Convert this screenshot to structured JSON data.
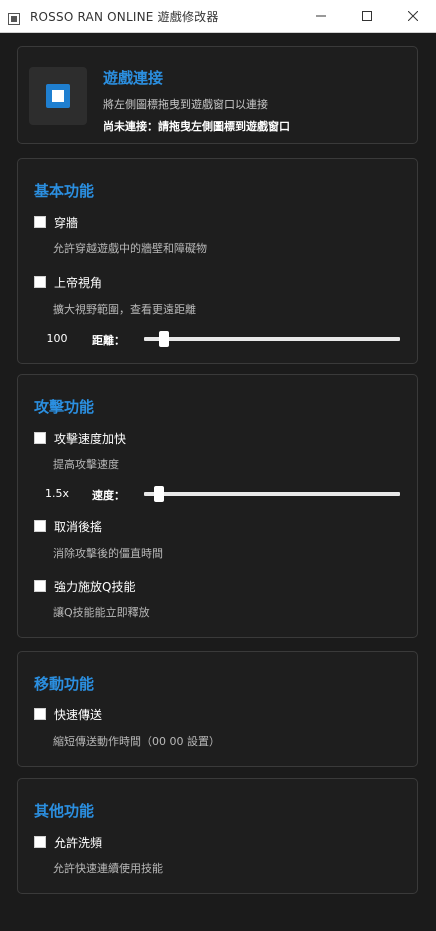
{
  "window": {
    "title": "ROSSO RAN ONLINE 遊戲修改器",
    "icon": "app-icon",
    "controls": [
      "minimize-icon",
      "maximize-icon",
      "close-icon"
    ]
  },
  "connection": {
    "title": "遊戲連接",
    "description": "將左側圖標拖曳到遊戲窗口以連接",
    "status": "尚未連接：請拖曳左側圖標到遊戲窗口",
    "logo_color": "#1f7fd0"
  },
  "basic": {
    "title": "基本功能",
    "wallhack": {
      "label": "穿牆",
      "description": "允許穿越遊戲中的牆壁和障礙物",
      "checked": false
    },
    "godview": {
      "label": "上帝視角",
      "description": "擴大視野範圍，查看更遠距離",
      "checked": false
    },
    "distance": {
      "value": "100",
      "label": "距離：",
      "level": 0.06
    }
  },
  "attack": {
    "title": "攻擊功能",
    "attack_speed": {
      "label": "攻擊速度加快",
      "description": "提高攻擊速度",
      "checked": false
    },
    "speed": {
      "value": "1.5x",
      "label": "速度：",
      "level": 0.04
    },
    "cancel_recovery": {
      "label": "取消後搖",
      "description": "消除攻擊後的僵直時間",
      "checked": false
    },
    "force_q": {
      "label": "強力施放Q技能",
      "description": "讓Q技能能立即釋放",
      "checked": false
    }
  },
  "movement": {
    "title": "移動功能",
    "fast_teleport": {
      "label": "快速傳送",
      "description": "縮短傳送動作時間（00 00 設置）",
      "checked": false
    }
  },
  "other": {
    "title": "其他功能",
    "spam_skills": {
      "label": "允許洗頻",
      "description": "允許快速連續使用技能",
      "checked": false
    }
  },
  "colors": {
    "accent": "#2b8fe0",
    "background": "#1b1b1b",
    "card_border": "#3a3a3a"
  }
}
